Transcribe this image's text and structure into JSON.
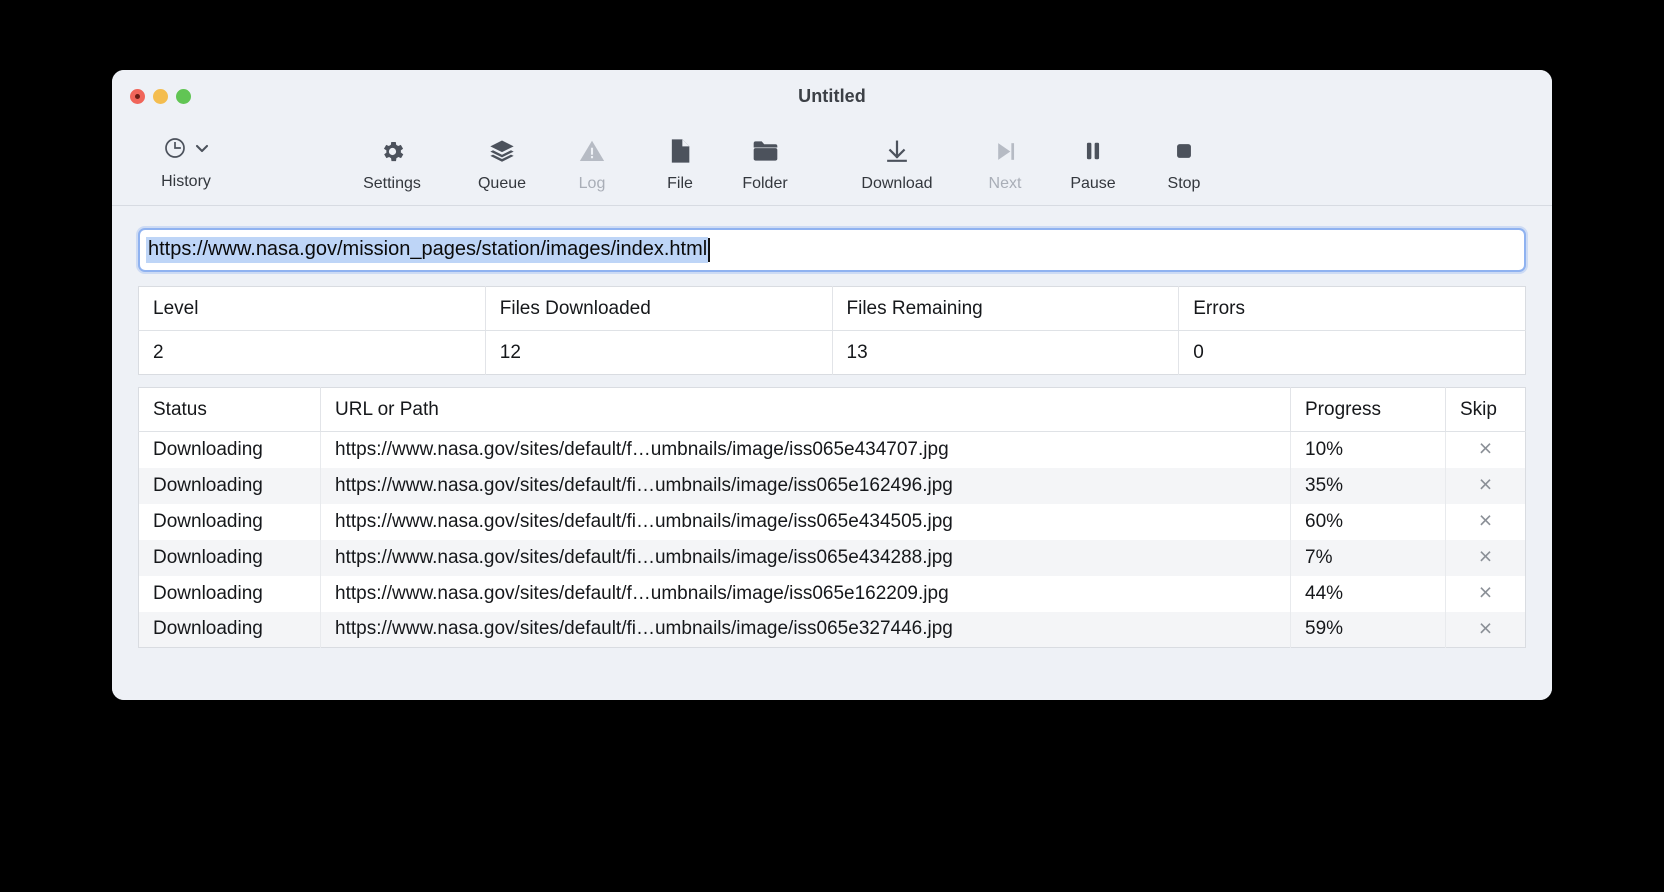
{
  "window": {
    "title": "Untitled",
    "traffic_lights": [
      "close",
      "minimize",
      "maximize"
    ]
  },
  "toolbar": {
    "items": [
      {
        "label": "History",
        "icon": "clock-icon",
        "disabled": false,
        "has_chevron": true
      },
      {
        "label": "Settings",
        "icon": "gear-icon",
        "disabled": false,
        "has_chevron": false
      },
      {
        "label": "Queue",
        "icon": "layers-icon",
        "disabled": false,
        "has_chevron": false
      },
      {
        "label": "Log",
        "icon": "warning-icon",
        "disabled": true,
        "has_chevron": false
      },
      {
        "label": "File",
        "icon": "file-icon",
        "disabled": false,
        "has_chevron": false
      },
      {
        "label": "Folder",
        "icon": "folder-icon",
        "disabled": false,
        "has_chevron": false
      },
      {
        "label": "Download",
        "icon": "download-icon",
        "disabled": false,
        "has_chevron": false
      },
      {
        "label": "Next",
        "icon": "skip-next-icon",
        "disabled": true,
        "has_chevron": false
      },
      {
        "label": "Pause",
        "icon": "pause-icon",
        "disabled": false,
        "has_chevron": false
      },
      {
        "label": "Stop",
        "icon": "stop-icon",
        "disabled": false,
        "has_chevron": false
      }
    ]
  },
  "address_bar": {
    "value": "https://www.nasa.gov/mission_pages/station/images/index.html",
    "placeholder": "",
    "selected": true,
    "focus_ring_color": "#8fb2f0",
    "selection_color": "#bed5f7"
  },
  "stats": {
    "headers": [
      "Level",
      "Files Downloaded",
      "Files Remaining",
      "Errors"
    ],
    "values": [
      "2",
      "12",
      "13",
      "0"
    ]
  },
  "downloads": {
    "headers": [
      "Status",
      "URL or Path",
      "Progress",
      "Skip"
    ],
    "skip_glyph": "×",
    "rows": [
      {
        "status": "Downloading",
        "url": "https://www.nasa.gov/sites/default/f…umbnails/image/iss065e434707.jpg",
        "progress": "10%",
        "skip": "×"
      },
      {
        "status": "Downloading",
        "url": "https://www.nasa.gov/sites/default/fi…umbnails/image/iss065e162496.jpg",
        "progress": "35%",
        "skip": "×"
      },
      {
        "status": "Downloading",
        "url": "https://www.nasa.gov/sites/default/fi…umbnails/image/iss065e434505.jpg",
        "progress": "60%",
        "skip": "×"
      },
      {
        "status": "Downloading",
        "url": "https://www.nasa.gov/sites/default/fi…umbnails/image/iss065e434288.jpg",
        "progress": "7%",
        "skip": "×"
      },
      {
        "status": "Downloading",
        "url": "https://www.nasa.gov/sites/default/f…umbnails/image/iss065e162209.jpg",
        "progress": "44%",
        "skip": "×"
      },
      {
        "status": "Downloading",
        "url": "https://www.nasa.gov/sites/default/fi…umbnails/image/iss065e327446.jpg",
        "progress": "59%",
        "skip": "×"
      }
    ]
  },
  "colors": {
    "window_bg": "#eef1f6",
    "desktop_bg": "#000000",
    "accent": "#8fb2f0",
    "text": "#16181b",
    "icon": "#4c525c",
    "icon_disabled": "#b6bbc4"
  }
}
